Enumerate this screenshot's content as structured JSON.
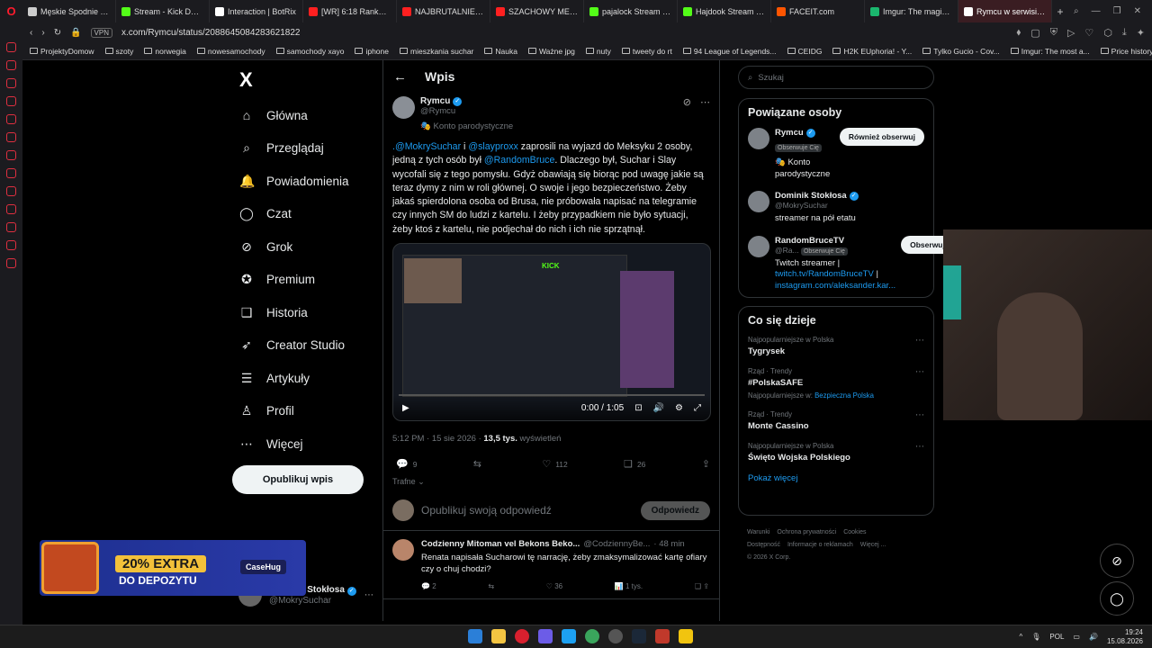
{
  "browser": {
    "tabs": [
      {
        "title": "Męskie Spodnie THE",
        "color": "#cccccc"
      },
      {
        "title": "Stream - Kick Dashb",
        "color": "#53fc18"
      },
      {
        "title": "Interaction | BotRix",
        "color": "#ffffff"
      },
      {
        "title": "[WR] 6:18 Ranked Bu",
        "color": "#ff2020"
      },
      {
        "title": "NAJBRUTALNIEJSZY",
        "color": "#ff2020"
      },
      {
        "title": "SZACHOWY MENTOR",
        "color": "#ff2020"
      },
      {
        "title": "pajalock Stream - Wa",
        "color": "#53fc18"
      },
      {
        "title": "Hajdook Stream - Wa",
        "color": "#53fc18"
      },
      {
        "title": "FACEIT.com",
        "color": "#ff5500"
      },
      {
        "title": "Imgur: The magic of t",
        "color": "#1bb76e"
      },
      {
        "title": "Rymcu w serwisie X: „@M",
        "color": "#ffffff"
      }
    ],
    "new_tab": "+",
    "vpn": "VPN",
    "url": "x.com/Rymcu/status/2088645084283621822",
    "bookmarks": [
      "ProjektyDomow",
      "szoty",
      "norwegia",
      "nowesamochody",
      "samochody xayo",
      "iphone",
      "mieszkania suchar",
      "Nauka",
      "Ważne jpg",
      "nuty",
      "tweety do rt",
      "94 League of Legends...",
      "CEIDG",
      "H2K EUphoria! - Y...",
      "Tylko Gucio - Cov...",
      "Imgur: The most a...",
      "Price history, price..."
    ]
  },
  "nav": {
    "logo": "X",
    "items": [
      {
        "label": "Główna",
        "icon": "⌂",
        "name": "home"
      },
      {
        "label": "Przeglądaj",
        "icon": "⌕",
        "name": "explore"
      },
      {
        "label": "Powiadomienia",
        "icon": "🔔",
        "name": "notifications"
      },
      {
        "label": "Czat",
        "icon": "◯",
        "name": "chat"
      },
      {
        "label": "Grok",
        "icon": "⊘",
        "name": "grok"
      },
      {
        "label": "Premium",
        "icon": "✪",
        "name": "premium"
      },
      {
        "label": "Historia",
        "icon": "❑",
        "name": "bookmarks"
      },
      {
        "label": "Creator Studio",
        "icon": "➶",
        "name": "creator-studio"
      },
      {
        "label": "Artykuły",
        "icon": "☰",
        "name": "articles"
      },
      {
        "label": "Profil",
        "icon": "♙",
        "name": "profile"
      },
      {
        "label": "Więcej",
        "icon": "⋯",
        "name": "more"
      }
    ],
    "post_button": "Opublikuj wpis",
    "account": {
      "name": "Dominik Stokłosa",
      "handle": "@MokrySuchar"
    }
  },
  "promo": {
    "big": "20% EXTRA",
    "small": "DO DEPOZYTU",
    "brand": "CaseHug"
  },
  "main": {
    "header_title": "Wpis",
    "tweet": {
      "name": "Rymcu",
      "handle": "@Rymcu",
      "parody": "Konto parodystyczne",
      "mention1": ".@MokrySuchar",
      "and": " i ",
      "mention2": "@slayproxx",
      "text_a": " zaprosili na wyjazd do Meksyku 2 osoby, jedną z tych osób był ",
      "mention3": "@RandomBruce",
      "text_b": ". Dlaczego był, Suchar i Slay wycofali się z tego pomysłu. Gdyż obawiają się biorąc pod uwagę jakie są teraz dymy z nim w roli głównej. O swoje i jego bezpieczeństwo. Żeby jakaś spierdolona osoba od Brusa, nie próbowała napisać na telegramie czy innych SM do ludzi z kartelu. I żeby przypadkiem nie było sytuacji, żeby ktoś z kartelu, nie podjechał do nich i ich nie sprzątnął.",
      "video_time": "0:00 / 1:05",
      "video_brand": "KICK",
      "meta_time": "5:12 PM · 15 sie 2026 · ",
      "views": "13,5 tys.",
      "views_label": " wyświetleń",
      "replies": "9",
      "reposts": "",
      "likes": "112",
      "bookmarks": "26"
    },
    "sort_label": "Trafne",
    "reply_placeholder": "Opublikuj swoją odpowiedź",
    "reply_button": "Odpowiedz",
    "reply1": {
      "name": "Codzienny Mitoman vel Bekons Beko...",
      "handle": "@CodziennyBe...",
      "time": "· 48 min",
      "text": "Renata napisała Sucharowi tę narrację, żeby zmaksymalizować kartę ofiary czy o chuj chodzi?",
      "replies": "2",
      "likes": "36",
      "views": "1 tys."
    }
  },
  "right": {
    "search_placeholder": "Szukaj",
    "people_title": "Powiązane osoby",
    "people": [
      {
        "name": "Rymcu",
        "handle": "",
        "badge": "Obserwuje Cię",
        "bio": "Konto parodystyczne",
        "button": "Również obserwuj"
      },
      {
        "name": "Dominik Stokłosa",
        "handle": "@MokrySuchar",
        "badge": "",
        "bio": "streamer na pół etatu",
        "button": ""
      },
      {
        "name": "RandomBruceTV",
        "handle": "@Ra...",
        "badge": "Obserwuje Cię",
        "bio": "Twitch streamer |",
        "link1": "twitch.tv/RandomBruceTV",
        "link2": "instagram.com/aleksander.kar...",
        "button": "Obserwujesz"
      }
    ],
    "trends_title": "Co się dzieje",
    "trends": [
      {
        "ctx": "Najpopularniejsze w Polska",
        "name": "Tygrysek",
        "sub": ""
      },
      {
        "ctx": "Rząd · Trendy",
        "name": "#PolskaSAFE",
        "sub": "Najpopularniejsze w: ",
        "sub_link": "Bezpieczna Polska"
      },
      {
        "ctx": "Rząd · Trendy",
        "name": "Monte Cassino",
        "sub": ""
      },
      {
        "ctx": "Najpopularniejsze w Polska",
        "name": "Święto Wojska Polskiego",
        "sub": ""
      }
    ],
    "show_more": "Pokaż więcej",
    "footer": [
      "Warunki",
      "Ochrona prywatności",
      "Cookies",
      "Dostępność",
      "Informacje o reklamach",
      "Więcej ...",
      "© 2026 X Corp."
    ]
  },
  "taskbar": {
    "lang": "POL",
    "time": "19:24",
    "date": "15.08.2026"
  }
}
